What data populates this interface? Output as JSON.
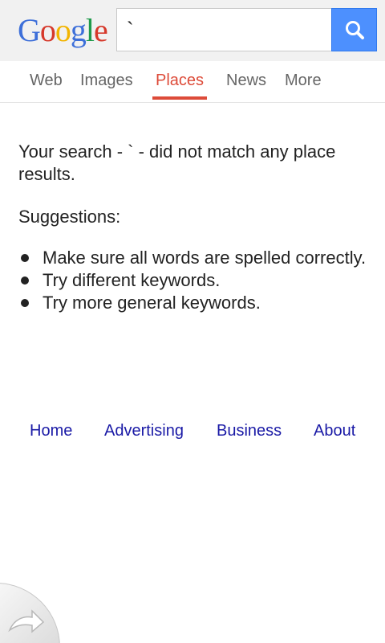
{
  "header": {
    "logo_letters": [
      "G",
      "o",
      "o",
      "g",
      "l",
      "e"
    ],
    "logo_colors": [
      "#3d6fd9",
      "#d6392b",
      "#f2b400",
      "#3d6fd9",
      "#1e9a4a",
      "#d6392b"
    ],
    "search": {
      "value": "`",
      "placeholder": ""
    },
    "search_button_icon": "search-icon",
    "accent_color": "#4d90fe"
  },
  "tabs": [
    {
      "label": "Web",
      "active": false
    },
    {
      "label": "Images",
      "active": false
    },
    {
      "label": "Places",
      "active": true
    },
    {
      "label": "News",
      "active": false
    },
    {
      "label": "More",
      "active": false
    }
  ],
  "main": {
    "message": "Your search - ` - did not match any place results.",
    "suggestions_title": "Suggestions:",
    "suggestions": [
      "Make sure all words are spelled correctly.",
      "Try different keywords.",
      "Try more general keywords."
    ]
  },
  "footer": {
    "links": [
      "Home",
      "Advertising",
      "Business",
      "About"
    ]
  },
  "corner_widget_icon": "share-arrow-icon"
}
